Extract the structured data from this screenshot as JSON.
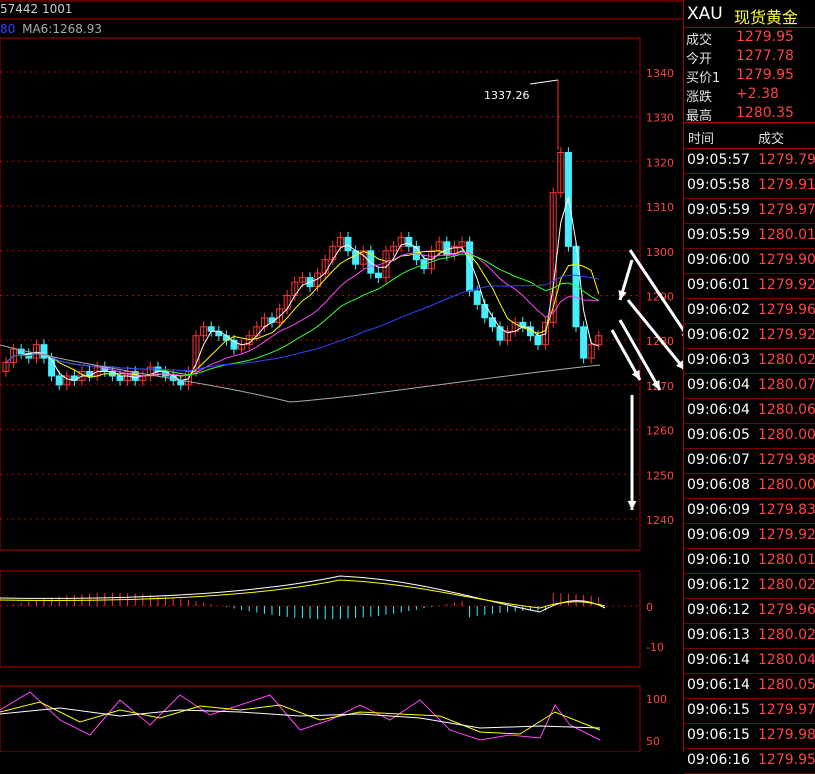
{
  "header": {
    "info": "57442 1001",
    "ma_prefix": "80",
    "ma_text": "MA6:1268.93"
  },
  "side": {
    "symbol": "XAU",
    "name": "现货黄金",
    "quotes": [
      {
        "key": "成交",
        "value": "1279.95"
      },
      {
        "key": "今开",
        "value": "1277.78"
      },
      {
        "key": "买价1",
        "value": "1279.95"
      },
      {
        "key": "涨跌",
        "value": "+2.38"
      },
      {
        "key": "最高",
        "value": "1280.35"
      }
    ],
    "ticks_header": {
      "time": "时间",
      "price": "成交"
    },
    "ticks": [
      {
        "time": "09:05:57",
        "price": "1279.79"
      },
      {
        "time": "09:05:58",
        "price": "1279.91"
      },
      {
        "time": "09:05:59",
        "price": "1279.97"
      },
      {
        "time": "09:05:59",
        "price": "1280.01"
      },
      {
        "time": "09:06:00",
        "price": "1279.90"
      },
      {
        "time": "09:06:01",
        "price": "1279.92"
      },
      {
        "time": "09:06:02",
        "price": "1279.96"
      },
      {
        "time": "09:06:02",
        "price": "1279.92"
      },
      {
        "time": "09:06:03",
        "price": "1280.02"
      },
      {
        "time": "09:06:04",
        "price": "1280.07"
      },
      {
        "time": "09:06:04",
        "price": "1280.06"
      },
      {
        "time": "09:06:05",
        "price": "1280.00"
      },
      {
        "time": "09:06:07",
        "price": "1279.98"
      },
      {
        "time": "09:06:08",
        "price": "1280.00"
      },
      {
        "time": "09:06:09",
        "price": "1279.83"
      },
      {
        "time": "09:06:09",
        "price": "1279.92"
      },
      {
        "time": "09:06:10",
        "price": "1280.01"
      },
      {
        "time": "09:06:12",
        "price": "1280.02"
      },
      {
        "time": "09:06:12",
        "price": "1279.96"
      },
      {
        "time": "09:06:13",
        "price": "1280.02"
      },
      {
        "time": "09:06:14",
        "price": "1280.04"
      },
      {
        "time": "09:06:14",
        "price": "1280.05"
      },
      {
        "time": "09:06:15",
        "price": "1279.97"
      },
      {
        "time": "09:06:15",
        "price": "1279.98"
      },
      {
        "time": "09:06:16",
        "price": "1279.95"
      }
    ]
  },
  "chart": {
    "price_ticks": [
      "1340",
      "1330",
      "1320",
      "1310",
      "1300",
      "1290",
      "1280",
      "1270",
      "1260",
      "1250",
      "1240"
    ],
    "macd_ticks": [
      "0",
      "-10"
    ],
    "osc_ticks": [
      "100",
      "50"
    ],
    "max_label": "1337.26",
    "colors": {
      "up": "#ff3333",
      "down": "#44eeff",
      "ma1": "#ffffff",
      "ma2": "#ffff00",
      "ma3": "#ff44ff",
      "ma4": "#33ff33",
      "ma5": "#3344ff",
      "ma6": "#aaaaaa",
      "grid": "#b00000"
    }
  }
}
